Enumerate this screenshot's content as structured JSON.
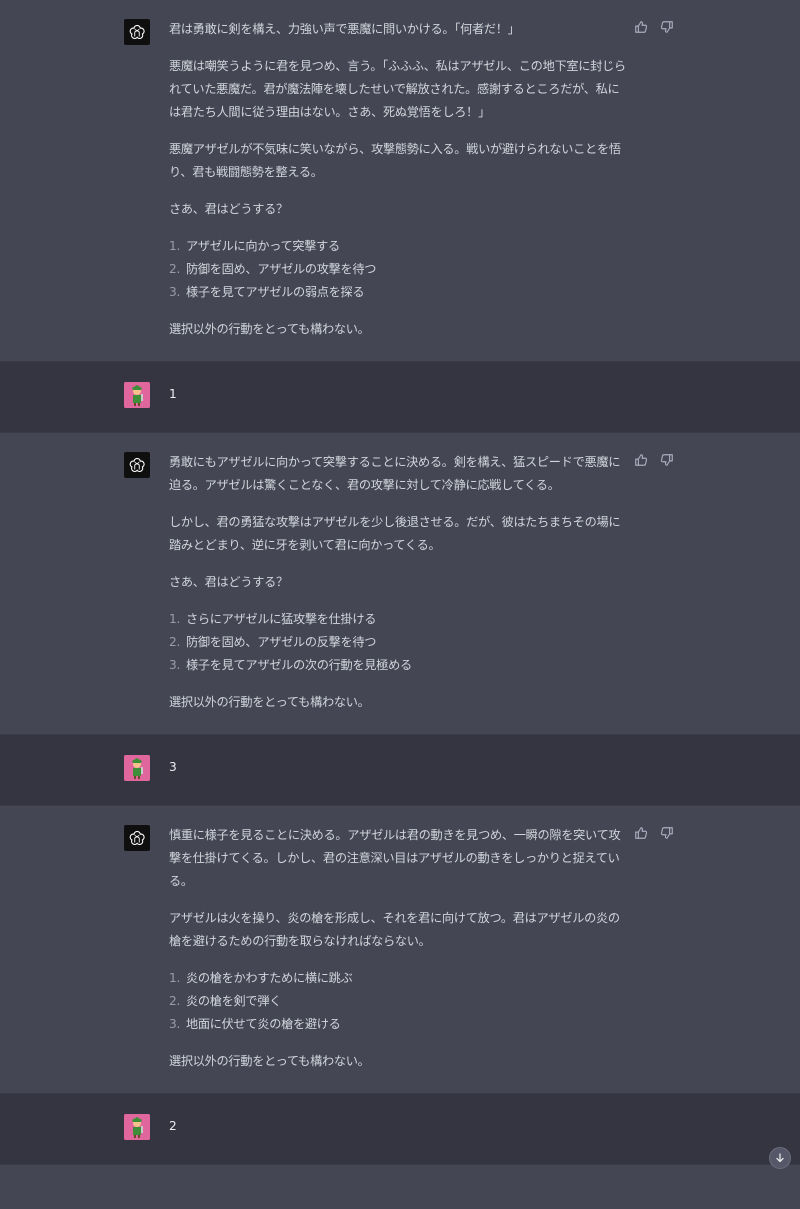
{
  "messages": [
    {
      "role": "assistant",
      "paragraphs_before": [
        "君は勇敢に剣を構え、力強い声で悪魔に問いかける。「何者だ！」",
        "悪魔は嘲笑うように君を見つめ、言う。「ふふふ、私はアザゼル、この地下室に封じられていた悪魔だ。君が魔法陣を壊したせいで解放された。感謝するところだが、私には君たち人間に従う理由はない。さあ、死ぬ覚悟をしろ！」",
        "悪魔アザゼルが不気味に笑いながら、攻撃態勢に入る。戦いが避けられないことを悟り、君も戦闘態勢を整える。",
        "さあ、君はどうする？"
      ],
      "options": [
        {
          "num": "1.",
          "text": "アザゼルに向かって突撃する"
        },
        {
          "num": "2.",
          "text": "防御を固め、アザゼルの攻撃を待つ"
        },
        {
          "num": "3.",
          "text": "様子を見てアザゼルの弱点を探る"
        }
      ],
      "closing": "選択以外の行動をとっても構わない。"
    },
    {
      "role": "user",
      "text": "1"
    },
    {
      "role": "assistant",
      "paragraphs_before": [
        "勇敢にもアザゼルに向かって突撃することに決める。剣を構え、猛スピードで悪魔に迫る。アザゼルは驚くことなく、君の攻撃に対して冷静に応戦してくる。",
        "しかし、君の勇猛な攻撃はアザゼルを少し後退させる。だが、彼はたちまちその場に踏みとどまり、逆に牙を剥いて君に向かってくる。",
        "さあ、君はどうする？"
      ],
      "options": [
        {
          "num": "1.",
          "text": "さらにアザゼルに猛攻撃を仕掛ける"
        },
        {
          "num": "2.",
          "text": "防御を固め、アザゼルの反撃を待つ"
        },
        {
          "num": "3.",
          "text": "様子を見てアザゼルの次の行動を見極める"
        }
      ],
      "closing": "選択以外の行動をとっても構わない。"
    },
    {
      "role": "user",
      "text": "3"
    },
    {
      "role": "assistant",
      "paragraphs_before": [
        "慎重に様子を見ることに決める。アザゼルは君の動きを見つめ、一瞬の隙を突いて攻撃を仕掛けてくる。しかし、君の注意深い目はアザゼルの動きをしっかりと捉えている。",
        "アザゼルは火を操り、炎の槍を形成し、それを君に向けて放つ。君はアザゼルの炎の槍を避けるための行動を取らなければならない。"
      ],
      "options": [
        {
          "num": "1.",
          "text": "炎の槍をかわすために横に跳ぶ"
        },
        {
          "num": "2.",
          "text": "炎の槍を剣で弾く"
        },
        {
          "num": "3.",
          "text": "地面に伏せて炎の槍を避ける"
        }
      ],
      "closing": "選択以外の行動をとっても構わない。"
    },
    {
      "role": "user",
      "text": "2"
    }
  ],
  "icons": {
    "assistant_avatar": "openai-logo-icon",
    "thumbs_up": "thumbs-up-icon",
    "thumbs_down": "thumbs-down-icon",
    "scroll_down": "arrow-down-icon"
  },
  "colors": {
    "assistant_bg": "#444654",
    "user_bg": "#343541",
    "text": "#d1d5db",
    "user_avatar": "#e0679e"
  }
}
